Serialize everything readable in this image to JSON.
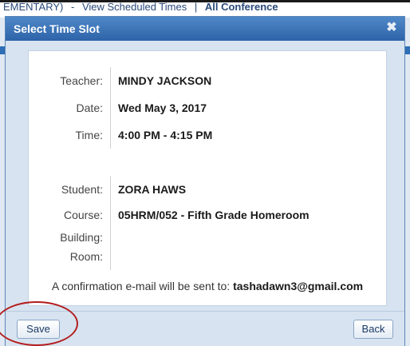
{
  "background": {
    "header_text_part1": "EMENTARY)",
    "header_link1": "View Scheduled Times",
    "header_sep": "|",
    "header_link2": "All Conference"
  },
  "dialog": {
    "title": "Select Time Slot",
    "close_symbol": "✖",
    "fields": {
      "teacher_label": "Teacher:",
      "teacher_value": "MINDY JACKSON",
      "date_label": "Date:",
      "date_value": "Wed May 3, 2017",
      "time_label": "Time:",
      "time_value": "4:00 PM - 4:15 PM",
      "student_label": "Student:",
      "student_value": "ZORA HAWS",
      "course_label": "Course:",
      "course_value": "05HRM/052 - Fifth Grade Homeroom",
      "building_label": "Building:",
      "building_value": "",
      "room_label": "Room:",
      "room_value": ""
    },
    "confirmation_text": "A confirmation e-mail will be sent to:",
    "confirmation_email": "tashadawn3@gmail.com",
    "buttons": {
      "save_label": "Save",
      "back_label": "Back"
    }
  },
  "colors": {
    "titlebar": "#2d63a8",
    "dialog_bg": "#d7e3f0",
    "annotation_circle": "#b31d1d"
  },
  "icons": {
    "close": "close-icon"
  }
}
